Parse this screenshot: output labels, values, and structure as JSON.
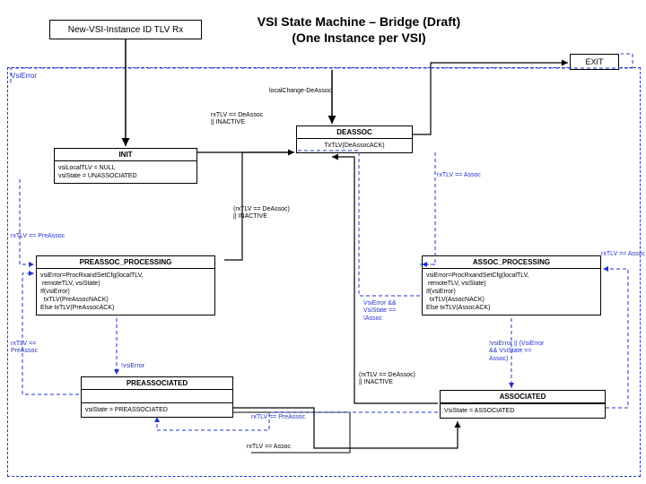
{
  "title_line1": "VSI State Machine – Bridge (Draft)",
  "title_line2": "(One Instance per VSI)",
  "input_box": "New-VSI-Instance ID TLV Rx",
  "exit_box": "EXIT",
  "vsi_error_label": "VsiError",
  "local_change_label": "localChange-DeAssoc",
  "init": {
    "name": "INIT",
    "body": "vsiLocalTLV = NULL\nvsiState = UNASSOCIATED"
  },
  "deassoc": {
    "name": "DEASSOC",
    "body": "TxTLV(DeAssocACK)"
  },
  "cond_deassoc1": "rxTLV == DeAssoc\n|| INACTIVE",
  "cond_rxassoc": "rxTLV == Assoc",
  "cond_deassoc2": "(rxTLV == DeAssoc)\n|| INACTIVE",
  "cond_rxpreassoc_left": "rxTLV == PreAssoc",
  "preassoc_processing": {
    "name": "PREASSOC_PROCESSING",
    "body": "vsiError=ProcRxandSetCfg(localTLV,\n remoteTLV, vsiState)\nIf(vsiError)\n  txTLV(PreAssocNACK)\nElse txTLV(PreAssocACK)"
  },
  "assoc_processing": {
    "name": "ASSOC_PROCESSING",
    "body": "vsiError=ProcRxandSetCfg(localTLV,\n remoteTLV, vsiState)\nIf(vsiError)\n  txTLV(AssocNACK)\nElse txTLV(AssocACK)"
  },
  "cond_rxpreassoc_bottom": "rxTLV ==\nPreAssoc",
  "cond_not_vsierror": "!vsiError",
  "preassociated": {
    "name": "PREASSOCIATED",
    "body": "vsiState = PREASSOCIATED"
  },
  "associated": {
    "name": "ASSOCIATED",
    "body": "VsiState = ASSOCIATED"
  },
  "cond_rxpreassoc_mid": "rxTLV == PreAssoc",
  "cond_rxassoc_bottom": "rxTLV == Assoc",
  "cond_vsierror_state": "VsiError &&\nVsiState ==\n!Assoc",
  "cond_not_vsierror_state": "!vsiError || (VsiError\n&& VsiState ==\nAssoc)",
  "cond_deassoc3": "(rxTLV == DeAssoc)\n|| INACTIVE",
  "cond_rxassoc_right": "rxTLV == Assoc"
}
